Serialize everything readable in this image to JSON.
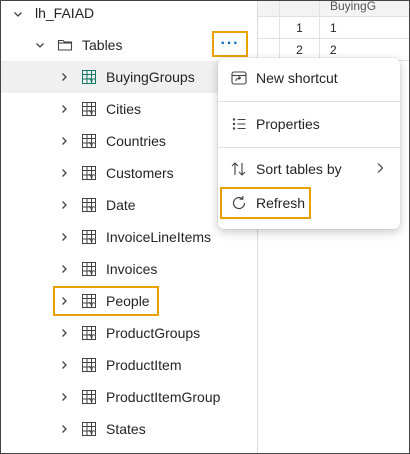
{
  "lakehouse": {
    "name": "lh_FAIAD"
  },
  "tables_folder": {
    "label": "Tables",
    "more_label": "···"
  },
  "tables": [
    {
      "label": "BuyingGroups"
    },
    {
      "label": "Cities"
    },
    {
      "label": "Countries"
    },
    {
      "label": "Customers"
    },
    {
      "label": "Date"
    },
    {
      "label": "InvoiceLineItems"
    },
    {
      "label": "Invoices"
    },
    {
      "label": "People"
    },
    {
      "label": "ProductGroups"
    },
    {
      "label": "ProductItem"
    },
    {
      "label": "ProductItemGroup"
    },
    {
      "label": "States"
    }
  ],
  "grid": {
    "header": "BuyingG",
    "rows": [
      {
        "n": "1",
        "v": "1"
      },
      {
        "n": "2",
        "v": "2"
      }
    ]
  },
  "context_menu": {
    "new_shortcut": "New shortcut",
    "properties": "Properties",
    "sort_tables_by": "Sort tables by",
    "refresh": "Refresh"
  },
  "colors": {
    "highlight": "#e8a200",
    "accent": "#0f6cbd",
    "selected_row": "#f0f0f0"
  }
}
